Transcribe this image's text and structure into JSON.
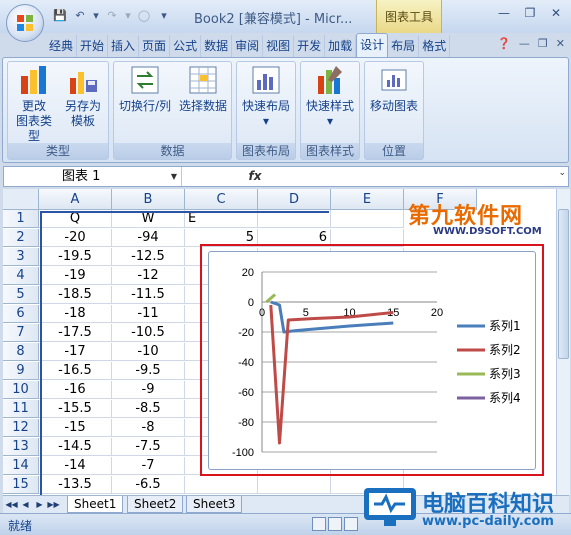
{
  "titlebar": {
    "title": "Book2 [兼容模式] - Micr...",
    "context_tab": "图表工具",
    "undo_icon": "undo-icon",
    "redo_icon": "redo-icon"
  },
  "ribbon": {
    "tabs": [
      "经典",
      "开始",
      "插入",
      "页面",
      "公式",
      "数据",
      "审阅",
      "视图",
      "开发",
      "加载",
      "设计",
      "布局",
      "格式"
    ],
    "active_tab": "设计",
    "groups": [
      {
        "label": "类型",
        "buttons": [
          {
            "label1": "更改",
            "label2": "图表类型",
            "icon": "change-chart-type-icon"
          },
          {
            "label1": "另存为",
            "label2": "模板",
            "icon": "save-as-template-icon"
          }
        ]
      },
      {
        "label": "数据",
        "buttons": [
          {
            "label1": "切换行/列",
            "label2": "",
            "icon": "switch-row-column-icon"
          },
          {
            "label1": "选择数据",
            "label2": "",
            "icon": "select-data-icon"
          }
        ]
      },
      {
        "label": "图表布局",
        "buttons": [
          {
            "label1": "快速布局",
            "label2": "▾",
            "icon": "quick-layout-icon"
          }
        ]
      },
      {
        "label": "图表样式",
        "buttons": [
          {
            "label1": "快速样式",
            "label2": "▾",
            "icon": "quick-style-icon"
          }
        ]
      },
      {
        "label": "位置",
        "buttons": [
          {
            "label1": "移动图表",
            "label2": "",
            "icon": "move-chart-icon"
          }
        ]
      }
    ]
  },
  "formula_bar": {
    "name_box": "图表 1",
    "fx": "fx",
    "value": ""
  },
  "columns": [
    "A",
    "B",
    "C",
    "D",
    "E",
    "F"
  ],
  "rows": [
    {
      "n": "1",
      "a": "Q",
      "b": "W",
      "c": "E",
      "d": "",
      "e": ""
    },
    {
      "n": "2",
      "a": "-20",
      "b": "-94",
      "c": "5",
      "d": "6",
      "e": ""
    },
    {
      "n": "3",
      "a": "-19.5",
      "b": "-12.5",
      "c": "",
      "d": "",
      "e": ""
    },
    {
      "n": "4",
      "a": "-19",
      "b": "-12",
      "c": "",
      "d": "",
      "e": ""
    },
    {
      "n": "5",
      "a": "-18.5",
      "b": "-11.5",
      "c": "",
      "d": "",
      "e": ""
    },
    {
      "n": "6",
      "a": "-18",
      "b": "-11",
      "c": "",
      "d": "",
      "e": ""
    },
    {
      "n": "7",
      "a": "-17.5",
      "b": "-10.5",
      "c": "",
      "d": "",
      "e": ""
    },
    {
      "n": "8",
      "a": "-17",
      "b": "-10",
      "c": "",
      "d": "",
      "e": ""
    },
    {
      "n": "9",
      "a": "-16.5",
      "b": "-9.5",
      "c": "",
      "d": "",
      "e": ""
    },
    {
      "n": "10",
      "a": "-16",
      "b": "-9",
      "c": "",
      "d": "",
      "e": ""
    },
    {
      "n": "11",
      "a": "-15.5",
      "b": "-8.5",
      "c": "",
      "d": "",
      "e": ""
    },
    {
      "n": "12",
      "a": "-15",
      "b": "-8",
      "c": "",
      "d": "",
      "e": ""
    },
    {
      "n": "13",
      "a": "-14.5",
      "b": "-7.5",
      "c": "",
      "d": "",
      "e": ""
    },
    {
      "n": "14",
      "a": "-14",
      "b": "-7",
      "c": "",
      "d": "",
      "e": ""
    },
    {
      "n": "15",
      "a": "-13.5",
      "b": "-6.5",
      "c": "",
      "d": "",
      "e": ""
    }
  ],
  "sheets": [
    "Sheet1",
    "Sheet2",
    "Sheet3"
  ],
  "status": {
    "ready": "就绪"
  },
  "watermarks": {
    "top": "第九软件网",
    "top_url": "WWW.D9SOFT.COM",
    "bottom": "电脑百科知识",
    "bottom_url": "www.pc-daily.com"
  },
  "chart_data": {
    "type": "line",
    "xlim": [
      0,
      20
    ],
    "ylim": [
      -100,
      20
    ],
    "x_ticks": [
      0,
      5,
      10,
      15,
      20
    ],
    "y_ticks": [
      20,
      0,
      -20,
      -40,
      -60,
      -80,
      -100
    ],
    "grid": true,
    "legend_position": "right",
    "series": [
      {
        "name": "系列1",
        "color": "#4a7ebb",
        "points": [
          [
            1,
            0
          ],
          [
            2,
            -2
          ],
          [
            2.5,
            -20
          ],
          [
            4,
            -19
          ],
          [
            6,
            -18
          ],
          [
            10,
            -16
          ],
          [
            15,
            -14
          ]
        ]
      },
      {
        "name": "系列2",
        "color": "#be4b48",
        "points": [
          [
            1,
            -2
          ],
          [
            2,
            -94
          ],
          [
            3,
            -12
          ],
          [
            6,
            -11
          ],
          [
            10,
            -10
          ],
          [
            15,
            -7
          ]
        ]
      },
      {
        "name": "系列3",
        "color": "#98b954",
        "points": [
          [
            0.5,
            0
          ],
          [
            1.5,
            5
          ]
        ]
      },
      {
        "name": "系列4",
        "color": "#7d60a0",
        "points": []
      }
    ]
  }
}
